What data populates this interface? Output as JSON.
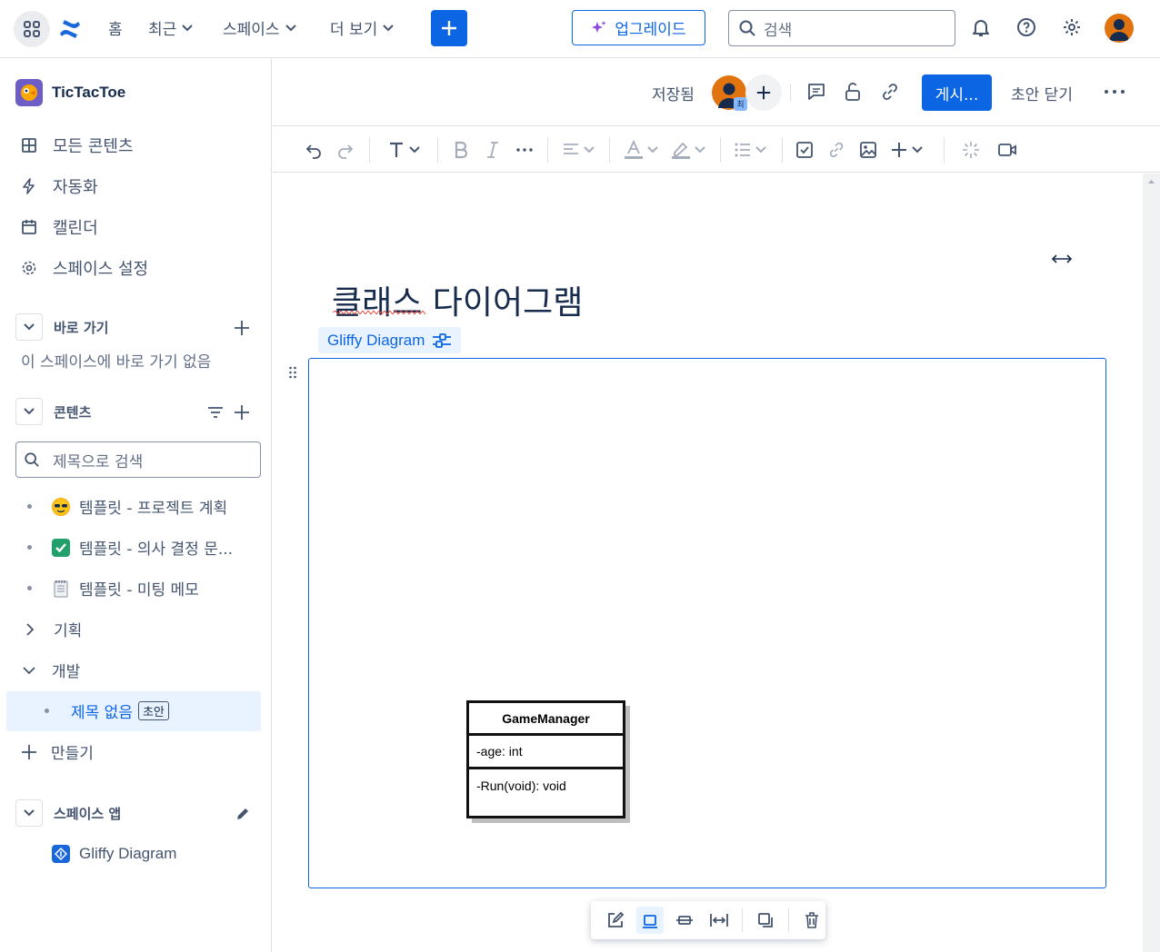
{
  "topnav": {
    "home": "홈",
    "recent": "최근",
    "spaces": "스페이스",
    "more": "더 보기",
    "upgrade": "업그레이드",
    "search_placeholder": "검색"
  },
  "sidebar": {
    "space_name": "TicTacToe",
    "items": [
      {
        "label": "모든 콘텐츠",
        "icon": "grid-icon"
      },
      {
        "label": "자동화",
        "icon": "lightning-icon"
      },
      {
        "label": "캘린더",
        "icon": "calendar-icon"
      },
      {
        "label": "스페이스 설정",
        "icon": "gear-icon"
      }
    ],
    "shortcuts": {
      "title": "바로 가기",
      "empty": "이 스페이스에 바로 가기 없음"
    },
    "content": {
      "title": "콘텐츠",
      "search_placeholder": "제목으로 검색",
      "tree": [
        {
          "label": "템플릿 - 프로젝트 계획",
          "emoji": "😎"
        },
        {
          "label": "템플릿 - 의사 결정 문...",
          "emoji": "✅"
        },
        {
          "label": "템플릿 - 미팅 메모",
          "emoji": "🗒"
        },
        {
          "label": "기획"
        },
        {
          "label": "개발"
        },
        {
          "label": "제목 없음",
          "badge": "초안"
        }
      ],
      "create": "만들기"
    },
    "apps": {
      "title": "스페이스 앱",
      "items": [
        {
          "label": "Gliffy Diagram"
        }
      ]
    }
  },
  "editor": {
    "saved": "저장됨",
    "publish": "게시...",
    "close_draft": "초안 닫기",
    "avatar_badge": "최",
    "page_title": "클래스 다이어그램",
    "macro_label": "Gliffy Diagram",
    "uml": {
      "class_name": "GameManager",
      "attribute": "-age: int",
      "operation": "-Run(void): void"
    }
  },
  "colors": {
    "accent": "#0c66e4",
    "text": "#172b4d",
    "subtle": "#44546f"
  }
}
